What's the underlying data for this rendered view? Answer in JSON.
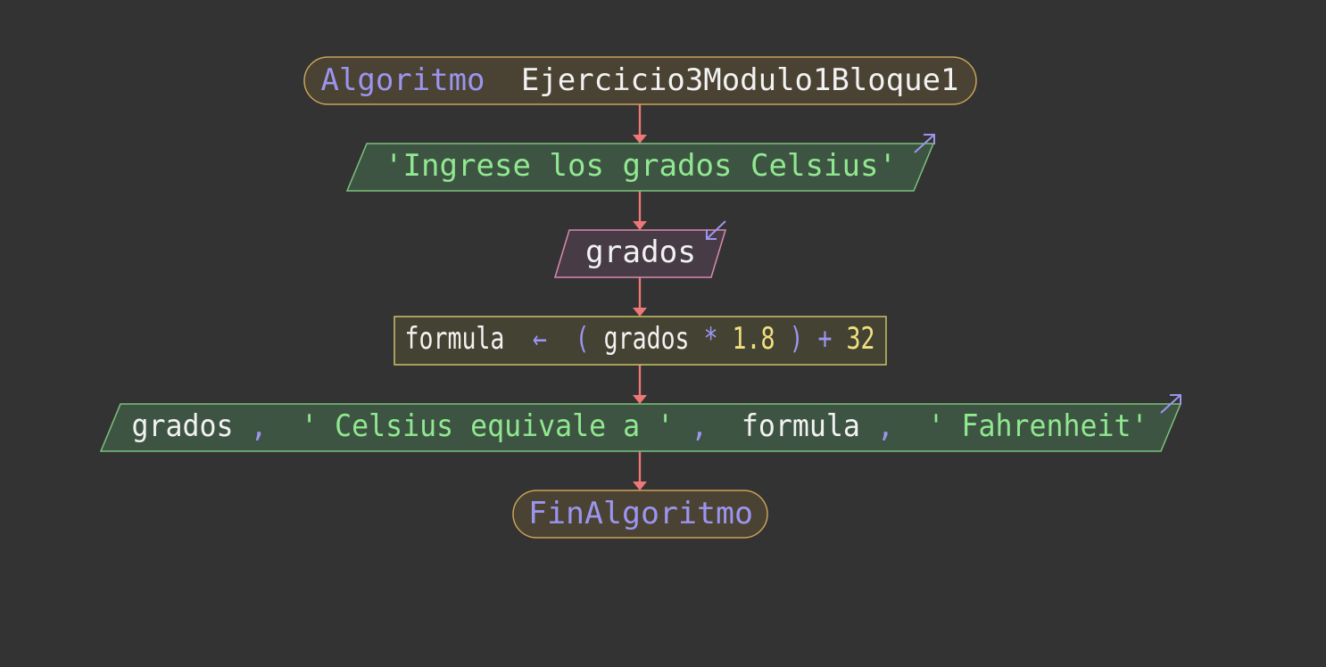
{
  "colors": {
    "background": "#333333",
    "keyword": "#9c95f0",
    "identifier": "#f2f2f2",
    "string": "#90e890",
    "number": "#f0e080",
    "operator": "#9c95f0",
    "connector": "#ee7777",
    "terminal_fill": "#4a4232",
    "terminal_stroke": "#c9a35a",
    "output_fill": "#3e5442",
    "output_stroke": "#7cc27c",
    "input_fill": "#473c46",
    "input_stroke": "#d98ab0",
    "process_fill": "#444232",
    "process_stroke": "#c9c266"
  },
  "flowchart": {
    "start": {
      "keyword": "Algoritmo",
      "name": "Ejercicio3Modulo1Bloque1"
    },
    "output_1": {
      "icon": "output-arrow-icon",
      "string": "'Ingrese los grados Celsius'"
    },
    "input_1": {
      "icon": "input-arrow-icon",
      "variable": "grados"
    },
    "process_1": {
      "target": "formula",
      "assign": "←",
      "open_paren": "(",
      "operand": "grados",
      "multiply": "*",
      "factor": "1.8",
      "close_paren": ")",
      "plus": "+",
      "addend": "32"
    },
    "output_2": {
      "icon": "output-arrow-icon",
      "var_1": "grados",
      "sep_1": ",",
      "str_1": "' Celsius equivale a '",
      "sep_2": ",",
      "var_2": "formula",
      "sep_3": ",",
      "str_2": "' Fahrenheit'"
    },
    "end": {
      "keyword": "FinAlgoritmo"
    }
  }
}
